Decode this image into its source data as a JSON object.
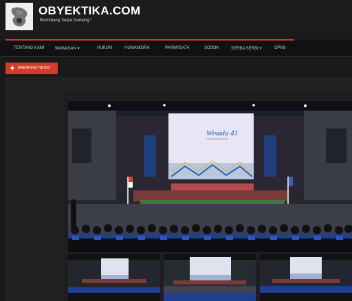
{
  "header": {
    "site_title": "OBYEKTIKA.COM",
    "tagline": "Berimbang Tanpa Gamang !"
  },
  "nav": {
    "items": [
      {
        "label": "TENTANG KAMI"
      },
      {
        "label": "WAWASAN ▾"
      },
      {
        "label": "HUKUM"
      },
      {
        "label": "HUMANIORA"
      },
      {
        "label": "PARIWISATA"
      },
      {
        "label": "SOSOK"
      },
      {
        "label": "SERBA SERBI ▾"
      },
      {
        "label": "OPINI"
      }
    ]
  },
  "breaking": {
    "label": "BREAKING NEWS"
  },
  "photo": {
    "slide_title": "Wisuda 41",
    "slide_subtitle": "Upacara Wisuda Ke-41"
  },
  "colors": {
    "accent": "#d73a2d",
    "nav_bg": "#111111",
    "page_bg": "#1a1a1a",
    "slide_blue": "#1b5fa8"
  }
}
